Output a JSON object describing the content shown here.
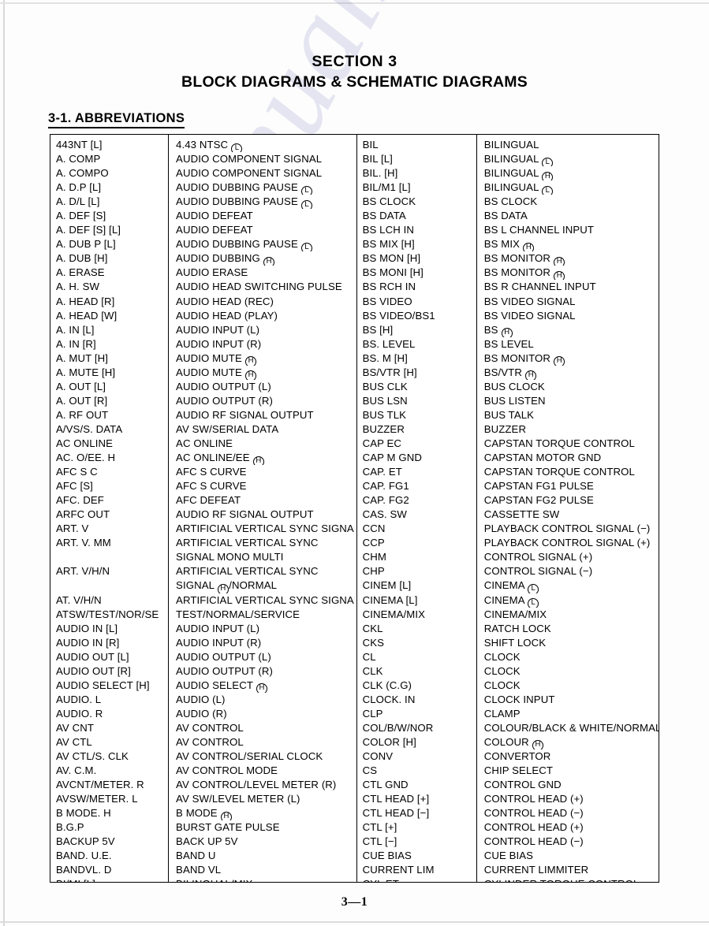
{
  "document": {
    "section_number": "SECTION 3",
    "section_title": "BLOCK DIAGRAMS & SCHEMATIC DIAGRAMS",
    "subsection_title": "3-1.  ABBREVIATIONS",
    "page_footer": "3—1",
    "watermark": "manualslib.com"
  },
  "table": {
    "left": {
      "abbr": [
        "443NT [L]",
        "A. COMP",
        "A. COMPO",
        "A. D.P [L]",
        "A. D/L [L]",
        "A. DEF [S]",
        "A. DEF [S] [L]",
        "A. DUB P [L]",
        "A. DUB [H]",
        "A. ERASE",
        "A. H. SW",
        "A. HEAD [R]",
        "A. HEAD [W]",
        "A. IN [L]",
        "A. IN [R]",
        "A. MUT [H]",
        "A. MUTE [H]",
        "A. OUT [L]",
        "A. OUT [R]",
        "A. RF OUT",
        "A/VS/S. DATA",
        "AC ONLINE",
        "AC. O/EE. H",
        "AFC S C",
        "AFC [S]",
        "AFC. DEF",
        "ARFC OUT",
        "ART. V",
        "ART. V. MM",
        "",
        "ART. V/H/N",
        "",
        "AT. V/H/N",
        "ATSW/TEST/NOR/SE",
        "AUDIO IN [L]",
        "AUDIO IN [R]",
        "AUDIO OUT [L]",
        "AUDIO OUT [R]",
        "AUDIO SELECT [H]",
        "AUDIO. L",
        "AUDIO. R",
        "AV CNT",
        "AV CTL",
        "AV CTL/S. CLK",
        "AV. C.M.",
        "AVCNT/METER. R",
        "AVSW/METER. L",
        "B MODE. H",
        "B.G.P",
        "BACKUP 5V",
        "BAND. U.E.",
        "BANDVL. D",
        "BI/MI [L]"
      ],
      "def": [
        "4.43 NTSC Ⓛ",
        "AUDIO COMPONENT SIGNAL",
        "AUDIO COMPONENT SIGNAL",
        "AUDIO DUBBING PAUSE Ⓛ",
        "AUDIO DUBBING PAUSE Ⓛ",
        "AUDIO DEFEAT",
        "AUDIO DEFEAT",
        "AUDIO DUBBING PAUSE Ⓛ",
        "AUDIO DUBBING Ⓗ",
        "AUDIO ERASE",
        "AUDIO HEAD SWITCHING PULSE",
        "AUDIO HEAD (REC)",
        "AUDIO HEAD (PLAY)",
        "AUDIO INPUT (L)",
        "AUDIO INPUT (R)",
        "AUDIO MUTE Ⓗ",
        "AUDIO MUTE Ⓗ",
        "AUDIO OUTPUT (L)",
        "AUDIO OUTPUT (R)",
        "AUDIO RF SIGNAL OUTPUT",
        "AV SW/SERIAL DATA",
        "AC ONLINE",
        "AC ONLINE/EE Ⓗ",
        "AFC S CURVE",
        "AFC S CURVE",
        "AFC DEFEAT",
        "AUDIO RF SIGNAL OUTPUT",
        "ARTIFICIAL VERTICAL SYNC SIGNAL",
        "ARTIFICIAL VERTICAL SYNC",
        "SIGNAL MONO MULTI",
        "ARTIFICIAL VERTICAL SYNC",
        "SIGNAL Ⓗ/NORMAL",
        "ARTIFICIAL VERTICAL SYNC SIGNAL",
        "TEST/NORMAL/SERVICE",
        "AUDIO INPUT (L)",
        "AUDIO INPUT (R)",
        "AUDIO OUTPUT (L)",
        "AUDIO OUTPUT (R)",
        "AUDIO SELECT Ⓗ",
        "AUDIO (L)",
        "AUDIO (R)",
        "AV CONTROL",
        "AV CONTROL",
        "AV CONTROL/SERIAL CLOCK",
        "AV CONTROL MODE",
        "AV CONTROL/LEVEL METER (R)",
        "AV SW/LEVEL METER (L)",
        "B MODE Ⓗ",
        "BURST GATE PULSE",
        "BACK UP 5V",
        "BAND U",
        "BAND VL",
        "BILINGUAL/MIX Ⓛ"
      ]
    },
    "right": {
      "abbr": [
        "BIL",
        "BIL [L]",
        "BIL. [H]",
        "BIL/M1 [L]",
        "BS CLOCK",
        "BS DATA",
        "BS LCH IN",
        "BS MIX [H]",
        "BS MON [H]",
        "BS MONI [H]",
        "BS RCH IN",
        "BS VIDEO",
        "BS VIDEO/BS1",
        "BS [H]",
        "BS. LEVEL",
        "BS. M [H]",
        "BS/VTR [H]",
        "BUS CLK",
        "BUS LSN",
        "BUS TLK",
        "BUZZER",
        "CAP EC",
        "CAP M GND",
        "CAP. ET",
        "CAP. FG1",
        "CAP. FG2",
        "CAS. SW",
        "CCN",
        "CCP",
        "CHM",
        "CHP",
        "CINEM [L]",
        "CINEMA [L]",
        "CINEMA/MIX",
        "CKL",
        "CKS",
        "CL",
        "CLK",
        "CLK (C.G)",
        "CLOCK. IN",
        "CLP",
        "COL/B/W/NOR",
        "COLOR [H]",
        "CONV",
        "CS",
        "CTL GND",
        "CTL HEAD [+]",
        "CTL HEAD [−]",
        "CTL [+]",
        "CTL [−]",
        "CUE BIAS",
        "CURRENT LIM",
        "CYL ET"
      ],
      "def": [
        "BILINGUAL",
        "BILINGUAL Ⓛ",
        "BILINGUAL Ⓗ",
        "BILINGUAL Ⓛ",
        "BS CLOCK",
        "BS DATA",
        "BS L CHANNEL INPUT",
        "BS MIX Ⓗ",
        "BS MONITOR Ⓗ",
        "BS MONITOR Ⓗ",
        "BS R CHANNEL INPUT",
        "BS VIDEO SIGNAL",
        "BS VIDEO SIGNAL",
        "BS Ⓗ",
        "BS LEVEL",
        "BS MONITOR Ⓗ",
        "BS/VTR Ⓗ",
        "BUS CLOCK",
        "BUS LISTEN",
        "BUS TALK",
        "BUZZER",
        "CAPSTAN TORQUE CONTROL",
        "CAPSTAN MOTOR GND",
        "CAPSTAN TORQUE CONTROL",
        "CAPSTAN FG1 PULSE",
        "CAPSTAN FG2 PULSE",
        "CASSETTE SW",
        "PLAYBACK CONTROL SIGNAL (−)",
        "PLAYBACK CONTROL SIGNAL (+)",
        "CONTROL SIGNAL (+)",
        "CONTROL SIGNAL (−)",
        "CINEMA Ⓛ",
        "CINEMA Ⓛ",
        "CINEMA/MIX",
        "RATCH LOCK",
        "SHIFT LOCK",
        "CLOCK",
        "CLOCK",
        "CLOCK",
        "CLOCK INPUT",
        "CLAMP",
        "COLOUR/BLACK & WHITE/NORMAL",
        "COLOUR Ⓗ",
        "CONVERTOR",
        "CHIP SELECT",
        "CONTROL GND",
        "CONTROL HEAD (+)",
        "CONTROL HEAD (−)",
        "CONTROL HEAD (+)",
        "CONTROL HEAD (−)",
        "CUE BIAS",
        "CURRENT LIMMITER",
        "CYLINDER TORQUE CONTROL"
      ]
    }
  }
}
